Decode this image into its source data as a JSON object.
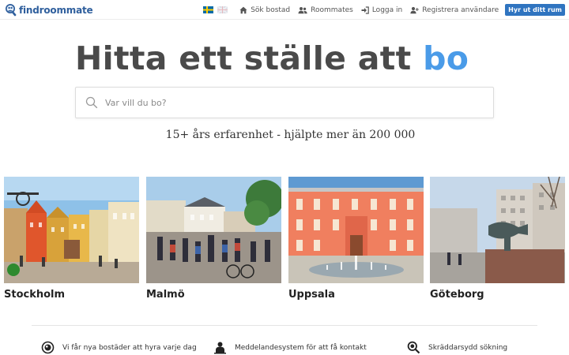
{
  "header": {
    "logo_text": "findroommate",
    "nav": {
      "search_label": "Sök bostad",
      "roommates_label": "Roommates",
      "login_label": "Logga in",
      "register_label": "Registrera användare"
    },
    "cta_label": "Hyr ut ditt rum"
  },
  "hero": {
    "headline_main": "Hitta ett ställe att ",
    "headline_accent": "bo",
    "search_placeholder": "Var vill du bo?",
    "tagline": "15+ års erfarenhet - hjälpte mer än 200 000"
  },
  "cities": [
    "Stockholm",
    "Malmö",
    "Uppsala",
    "Göteborg"
  ],
  "features": [
    "Vi får nya bostäder att hyra varje dag",
    "Meddelandesystem för att få kontakt",
    "Skräddarsydd sökning"
  ],
  "colors": {
    "brand": "#2f5f9d",
    "accent": "#4a9be8",
    "cta": "#2f74c0"
  }
}
